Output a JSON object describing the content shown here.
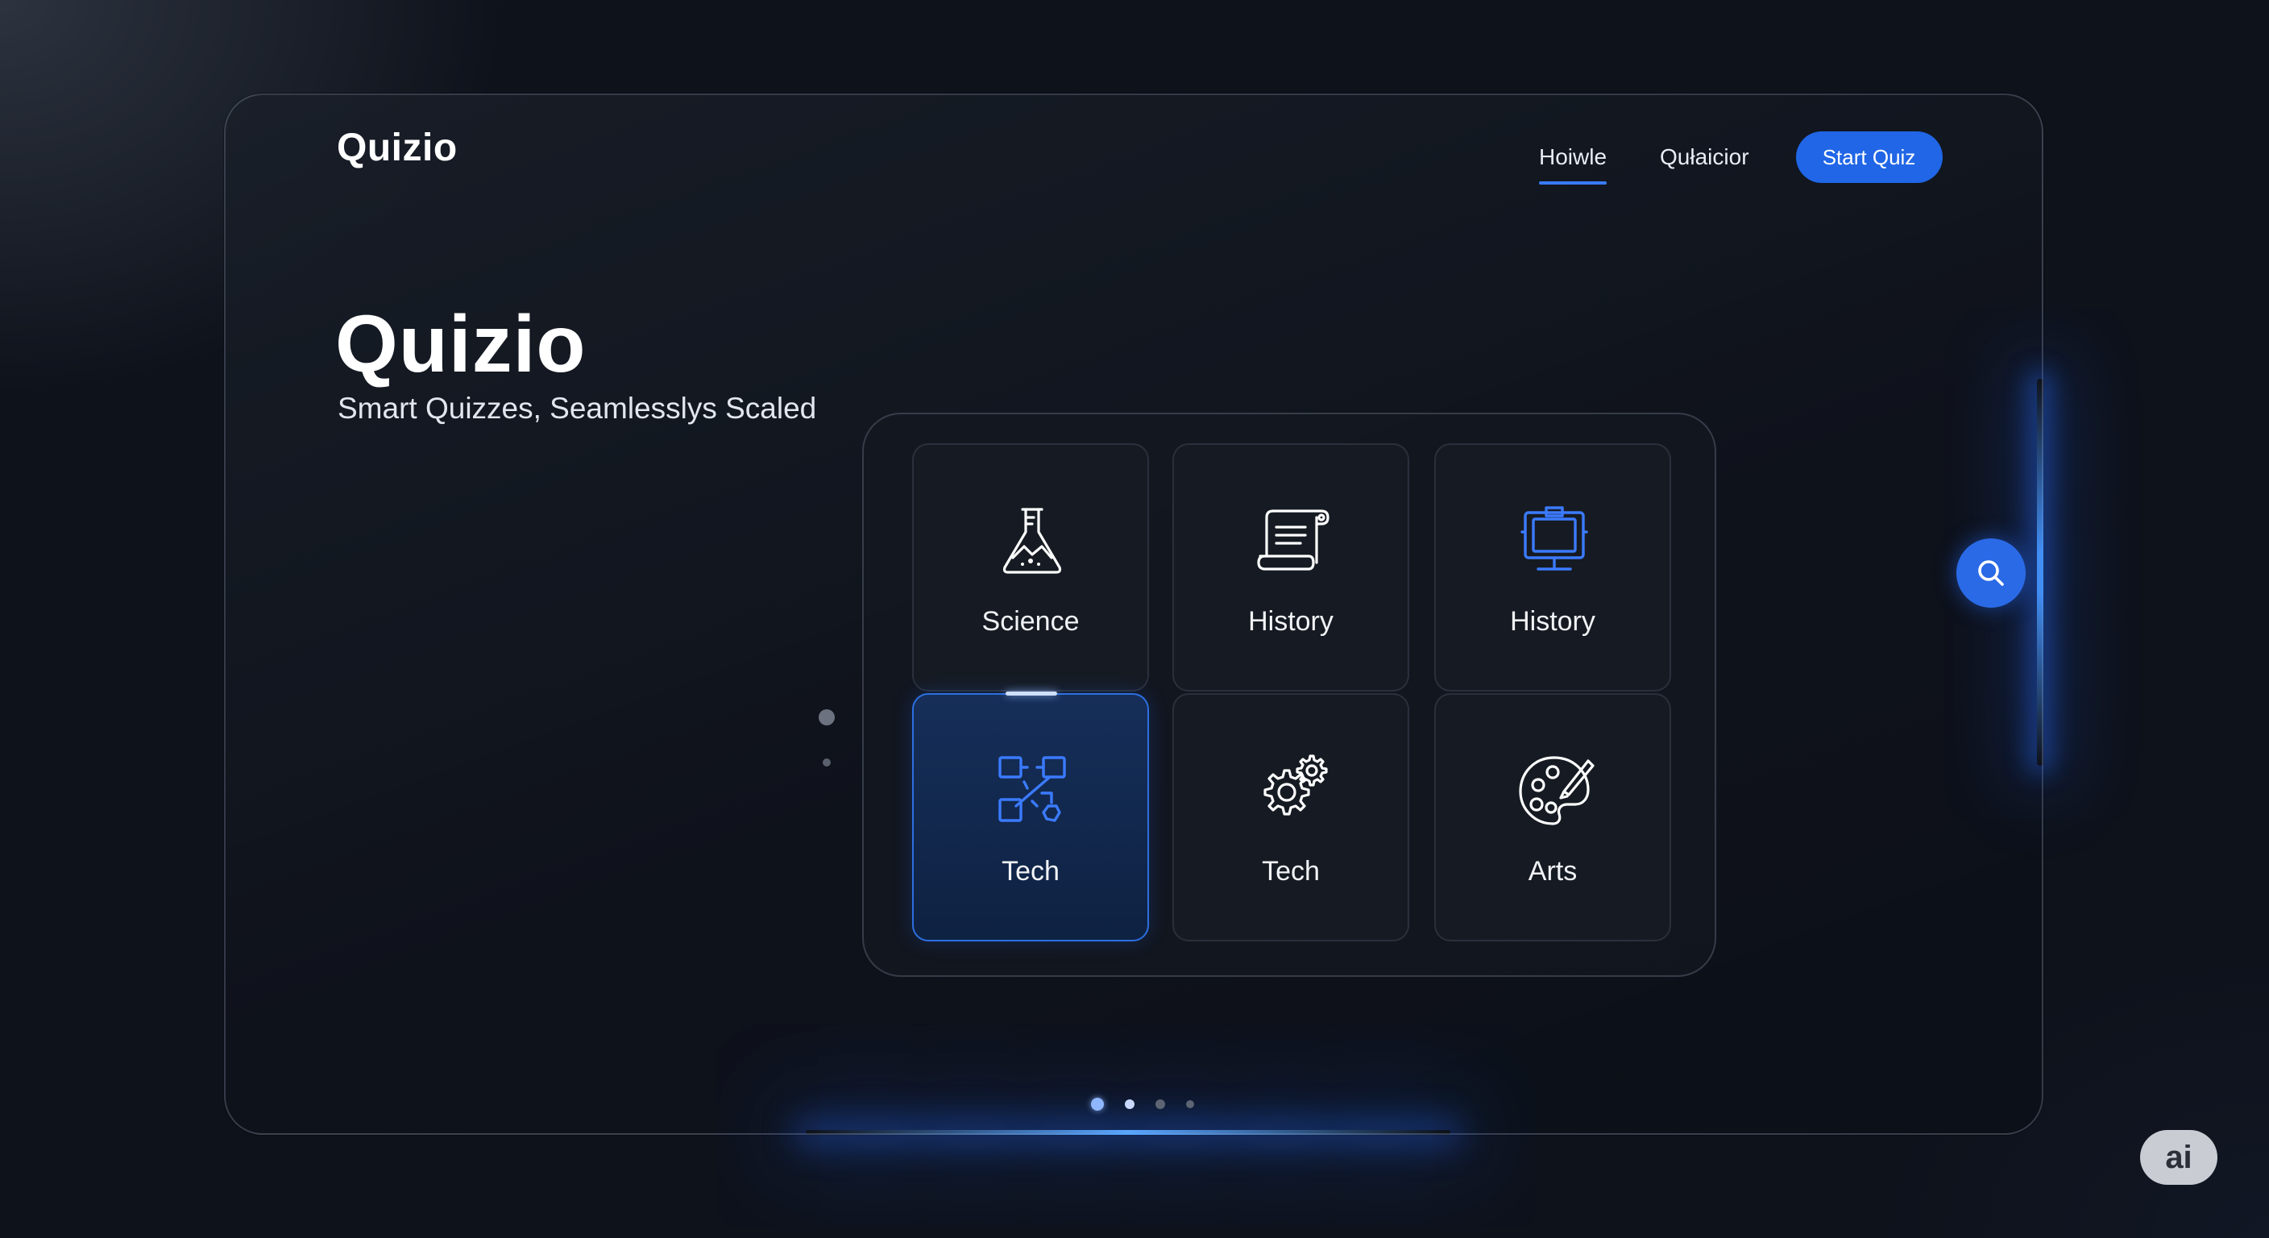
{
  "header": {
    "brand": "Quizio",
    "nav": [
      {
        "label": "Hoiwle",
        "active": true
      },
      {
        "label": "Qułaicior",
        "active": false
      }
    ],
    "start_button": "Start Quiz"
  },
  "hero": {
    "title": "Quizio",
    "subtitle": "Smart Quizzes, Seamlesslys Scaled"
  },
  "categories": [
    {
      "label": "Science",
      "icon": "flask-icon",
      "selected": false
    },
    {
      "label": "History",
      "icon": "scroll-icon",
      "selected": false
    },
    {
      "label": "History",
      "icon": "monitor-clipboard-icon",
      "selected": false
    },
    {
      "label": "Tech",
      "icon": "circuit-icon",
      "selected": true
    },
    {
      "label": "Tech",
      "icon": "gears-icon",
      "selected": false
    },
    {
      "label": "Arts",
      "icon": "palette-icon",
      "selected": false
    }
  ],
  "pager": {
    "pages": 4,
    "current": 1
  },
  "search_fab": {
    "icon": "search-icon"
  },
  "badge": {
    "text": "ai"
  },
  "colors": {
    "background": "#0e121b",
    "accent": "#2066e6",
    "selected_card": "#2c6fe0",
    "text": "#ffffff"
  }
}
